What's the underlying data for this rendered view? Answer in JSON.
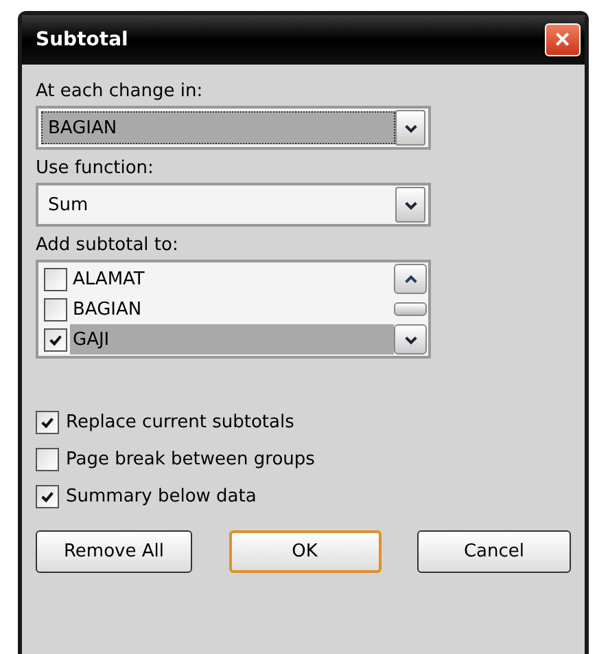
{
  "window": {
    "title": "Subtotal",
    "close": "✕"
  },
  "change_field": {
    "label": "At each change in:",
    "value": "BAGIAN",
    "focused": true
  },
  "function_field": {
    "label": "Use function:",
    "value": "Sum",
    "focused": false
  },
  "subtotal_list": {
    "label": "Add subtotal to:",
    "items": [
      {
        "label": "ALAMAT",
        "checked": false,
        "selected": false
      },
      {
        "label": "BAGIAN",
        "checked": false,
        "selected": false
      },
      {
        "label": "GAJI",
        "checked": true,
        "selected": true
      }
    ]
  },
  "options": [
    {
      "label": "Replace current subtotals",
      "checked": true
    },
    {
      "label": "Page break between groups",
      "checked": false
    },
    {
      "label": "Summary below data",
      "checked": true
    }
  ],
  "buttons": [
    {
      "label": "Remove All",
      "default": false
    },
    {
      "label": "OK",
      "default": true
    },
    {
      "label": "Cancel",
      "default": false
    }
  ]
}
